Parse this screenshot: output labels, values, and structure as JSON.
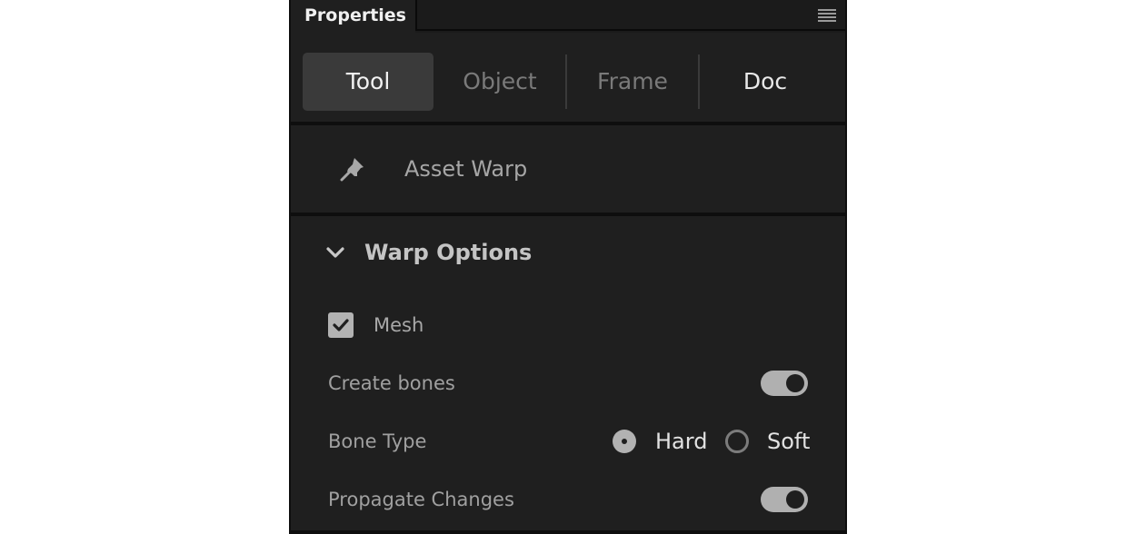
{
  "panel": {
    "title": "Properties",
    "menu_icon": "hamburger-menu-icon"
  },
  "tabs": [
    {
      "label": "Tool",
      "active": true
    },
    {
      "label": "Object",
      "active": false
    },
    {
      "label": "Frame",
      "active": false
    },
    {
      "label": "Doc",
      "active": false
    }
  ],
  "tool": {
    "icon": "pin-icon",
    "name": "Asset Warp"
  },
  "warp_options": {
    "title": "Warp Options",
    "expanded": true,
    "mesh": {
      "label": "Mesh",
      "checked": true
    },
    "create_bones": {
      "label": "Create bones",
      "on": true
    },
    "bone_type": {
      "label": "Bone Type",
      "options": [
        {
          "label": "Hard",
          "selected": true
        },
        {
          "label": "Soft",
          "selected": false
        }
      ]
    },
    "propagate_changes": {
      "label": "Propagate Changes",
      "on": true
    }
  },
  "colors": {
    "panel_bg": "#1f1f1f",
    "active_tab_bg": "#3a3a3a",
    "control_fill": "#b0b0b0"
  }
}
